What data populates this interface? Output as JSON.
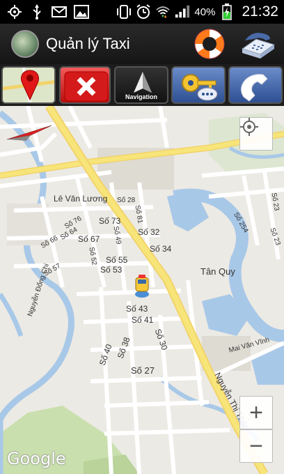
{
  "status_bar": {
    "battery_percent": "40%",
    "time": "21:32",
    "icons": [
      "gps-icon",
      "usb-icon",
      "gmail-icon",
      "image-icon",
      "vibrate-icon",
      "alarm-icon",
      "wifi-icon",
      "signal-icon",
      "battery-icon"
    ]
  },
  "title_bar": {
    "app_title": "Quản lý Taxi",
    "icons": [
      "app-logo-icon",
      "lifebuoy-icon",
      "telephone-icon"
    ]
  },
  "toolbar": {
    "buttons": [
      {
        "icon": "map-pin-icon"
      },
      {
        "icon": "close-icon"
      },
      {
        "icon": "navigation-arrow-icon",
        "label": "Navigation"
      },
      {
        "icon": "key-chat-icon"
      },
      {
        "icon": "phone-call-icon"
      }
    ]
  },
  "map": {
    "labels": {
      "le_van_luong": "Lê Văn Lương",
      "so_28": "Số 28",
      "so_76": "Số 76",
      "so_73": "Số 73",
      "so_64": "Số 64",
      "so_67": "Số 67",
      "so_32": "Số 32",
      "so_66": "Số 66",
      "so_34": "Số 34",
      "so_55": "Số 55",
      "so_57": "Số 57",
      "so_53": "Số 53",
      "so_52": "Số 52",
      "so_49": "Số 49",
      "so_81": "Số 81",
      "so_254": "Số 254",
      "so_23": "Số 23",
      "so_43": "Số 43",
      "so_41": "Số 41",
      "so_30": "Số 30",
      "so_40": "Số 40",
      "so_38": "Số 38",
      "so_27": "Số 27",
      "tan_quy": "Tân Quy",
      "nguyen_dong_chi": "Nguyễn Đổng Chi",
      "mai_van_vinh": "Mai Văn Vĩnh",
      "nguyen_thi_thap": "Nguyễn Thị Thập",
      "google": "Google"
    },
    "controls": {
      "zoom_in": "+",
      "zoom_out": "−"
    }
  },
  "colors": {
    "map_background": "#eceae4",
    "road_major": "#f7e57a",
    "road_minor": "#ffffff",
    "water": "#a8c8e8",
    "park": "#c9dfae"
  }
}
